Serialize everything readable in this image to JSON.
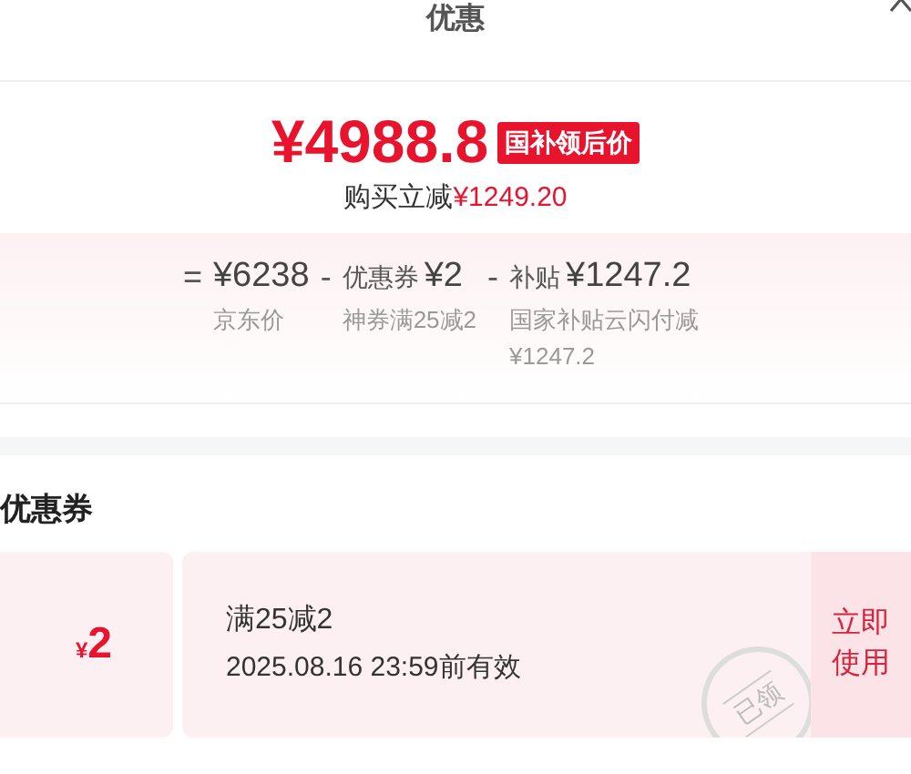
{
  "header": {
    "title": "优惠"
  },
  "price": {
    "amount": "¥4988.8",
    "badge": "国补领后价",
    "saving_label": "购买立减",
    "saving_amount": "¥1249.20"
  },
  "breakdown": [
    {
      "operator": "=",
      "amount": "¥6238",
      "note": "京东价"
    },
    {
      "operator": "-",
      "label": "优惠券",
      "amount": "¥2",
      "note": "神券满25减2"
    },
    {
      "operator": "-",
      "label": "补贴",
      "amount": "¥1247.2",
      "note": "国家补贴云闪付减¥1247.2"
    }
  ],
  "coupons_section": {
    "title": "优惠券",
    "coupons": [
      {
        "currency": "¥",
        "value": "2",
        "condition": "满25减2",
        "validity": "2025.08.16 23:59前有效",
        "stamp": "已领",
        "action": "立即使用"
      }
    ]
  }
}
